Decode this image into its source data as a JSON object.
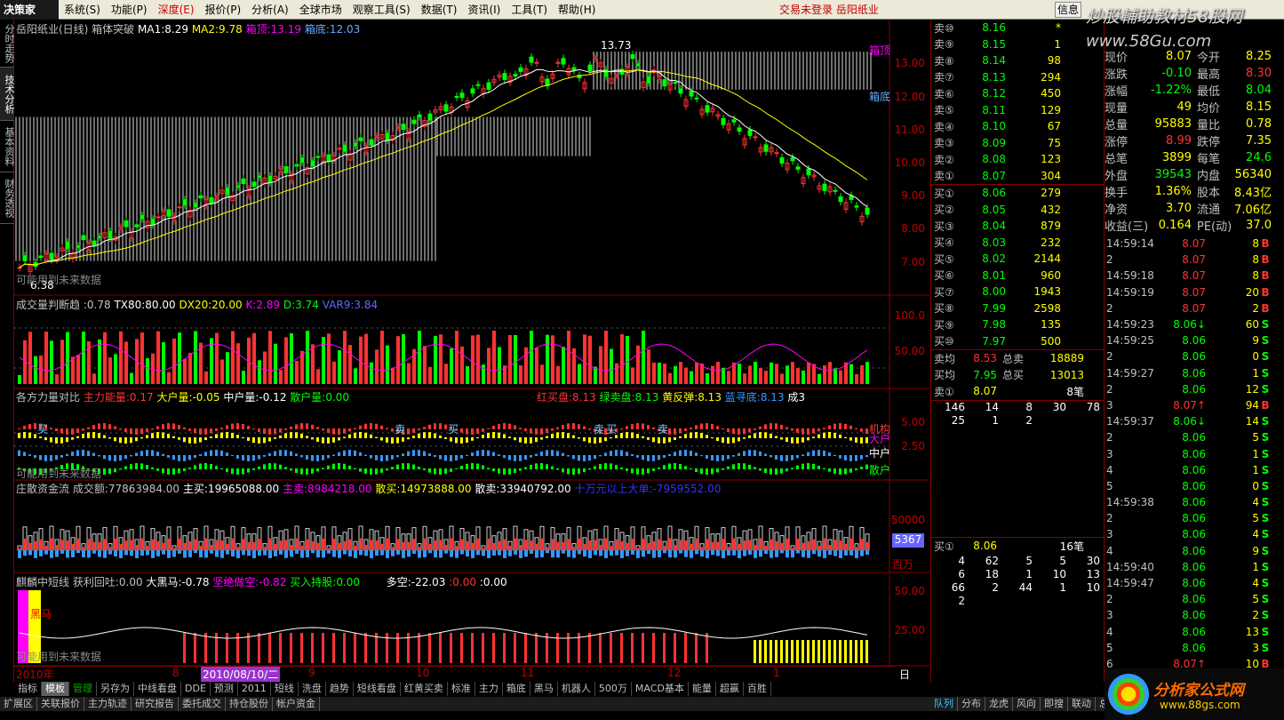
{
  "menu": {
    "logo": "决策家",
    "items": [
      "系统(S)",
      "功能(P)",
      "深度(E)",
      "报价(P)",
      "分析(A)",
      "全球市场",
      "观察工具(S)",
      "数据(T)",
      "资讯(I)",
      "工具(T)",
      "帮助(H)"
    ],
    "status": "交易未登录  岳阳纸业",
    "info": "信息",
    "watermark": "炒股輔助教材58股网",
    "watermark2": "www.58Gu.com"
  },
  "sidetabs": [
    "分时走势",
    "技术分析",
    "基本资料",
    "财务透视"
  ],
  "panel1": {
    "title": "岳阳纸业(日线) 箱体突破",
    "ma1": "MA1:8.29",
    "ma2": "MA2:9.78",
    "boxtop": "箱顶:13.19",
    "boxbottom": "箱底:12.03",
    "high_label": "13.73",
    "low_label": "6.38",
    "future": "可能用到未来数据",
    "boxtop_tag": "箱顶",
    "boxbottom_tag": "箱底",
    "axis": [
      "13.00",
      "12.00",
      "11.00",
      "10.00",
      "9.00",
      "8.00",
      "7.00"
    ]
  },
  "panel2": {
    "name": "成交量判断趋",
    "v1": ":0.78",
    "tx": "TX80:80.00",
    "dx": "DX20:20.00",
    "k": "K:2.89",
    "d": "D:3.74",
    "var9": "VAR9:3.84",
    "axis": [
      "100.0",
      "50.00"
    ]
  },
  "panel3": {
    "name": "各方力量对比",
    "zl": "主力能量:0.17",
    "dh": "大户量:-0.05",
    "zh": "中户量:-0.12",
    "sh": "散户量:0.00",
    "hm": "红买盘:8.13",
    "lm": "绿卖盘:8.13",
    "hf": "黄反弹:8.13",
    "ld": "蓝寻底:8.13",
    "cheng": "成3",
    "axis": [
      "5.00",
      "2.50"
    ],
    "tags": [
      "机构",
      "大户",
      "中户",
      "散户"
    ],
    "buy": "买",
    "sell": "卖",
    "future": "可能用到未来数据"
  },
  "panel4": {
    "name": "庄散资金流",
    "cje": "成交额:77863984.00",
    "zm": "主买:19965088.00",
    "zmai": "主卖:8984218.00",
    "sm": "散买:14973888.00",
    "smai": "散卖:33940792.00",
    "extra": "十万元以上大单:-7959552.00",
    "axis": [
      "50000"
    ],
    "box": "5367",
    "unit": "百万"
  },
  "panel5": {
    "name": "麒麟中短线",
    "hl": "获利回吐:0.00",
    "dhm": "大黑马:-0.78",
    "jj": "坚绝做空:-0.82",
    "mr": "买入持股:0.00",
    "dk": "多空:-22.03",
    "z1": ":0.00",
    "z2": ":0.00",
    "axis": [
      "50.00",
      "25.00"
    ],
    "hm": "黑马",
    "future": "可能用到未来数据"
  },
  "timeaxis": {
    "year": "2010年",
    "m8": "8",
    "date": "2010/08/10/二",
    "m9": "9",
    "m10": "10",
    "m11": "11",
    "m12": "12",
    "m1": "1",
    "period": "日线"
  },
  "orderbook": {
    "sells": [
      [
        "卖⑩",
        "8.16",
        "*"
      ],
      [
        "卖⑨",
        "8.15",
        "1"
      ],
      [
        "卖⑧",
        "8.14",
        "98"
      ],
      [
        "卖⑦",
        "8.13",
        "294"
      ],
      [
        "卖⑥",
        "8.12",
        "450"
      ],
      [
        "卖⑤",
        "8.11",
        "129"
      ],
      [
        "卖④",
        "8.10",
        "67"
      ],
      [
        "卖③",
        "8.09",
        "75"
      ],
      [
        "卖②",
        "8.08",
        "123"
      ],
      [
        "卖①",
        "8.07",
        "304"
      ]
    ],
    "buys": [
      [
        "买①",
        "8.06",
        "279"
      ],
      [
        "买②",
        "8.05",
        "432"
      ],
      [
        "买③",
        "8.04",
        "879"
      ],
      [
        "买④",
        "8.03",
        "232"
      ],
      [
        "买⑤",
        "8.02",
        "2144"
      ],
      [
        "买⑥",
        "8.01",
        "960"
      ],
      [
        "买⑦",
        "8.00",
        "1943"
      ],
      [
        "买⑧",
        "7.99",
        "2598"
      ],
      [
        "买⑨",
        "7.98",
        "135"
      ],
      [
        "买⑩",
        "7.97",
        "500"
      ]
    ],
    "avgsell": [
      "卖均",
      "8.53",
      "总卖",
      "18889"
    ],
    "avgbuy": [
      "买均",
      "7.95",
      "总买",
      "13013"
    ],
    "s1": [
      "卖①",
      "8.07",
      "8笔"
    ],
    "qrow1": [
      "146",
      "14",
      "8",
      "30",
      "78"
    ],
    "qrow2": [
      "25",
      "1",
      "2"
    ],
    "b1": [
      "买①",
      "8.06",
      "16笔"
    ],
    "brows": [
      [
        "4",
        "62",
        "5",
        "5",
        "30"
      ],
      [
        "6",
        "18",
        "1",
        "10",
        "13"
      ],
      [
        "66",
        "2",
        "44",
        "1",
        "10"
      ],
      [
        "2"
      ]
    ]
  },
  "quote": [
    [
      "现价",
      "8.07",
      "今开",
      "8.25"
    ],
    [
      "涨跌",
      "-0.10",
      "最高",
      "8.30"
    ],
    [
      "涨幅",
      "-1.22%",
      "最低",
      "8.04"
    ],
    [
      "现量",
      "49",
      "均价",
      "8.15"
    ],
    [
      "总量",
      "95883",
      "量比",
      "0.78"
    ],
    [
      "涨停",
      "8.99",
      "跌停",
      "7.35"
    ],
    [
      "总笔",
      "3899",
      "每笔",
      "24.6"
    ],
    [
      "外盘",
      "39543",
      "内盘",
      "56340"
    ],
    [
      "换手",
      "1.36%",
      "股本",
      "8.43亿"
    ],
    [
      "净资",
      "3.70",
      "流通",
      "7.06亿"
    ],
    [
      "收益(三)",
      "0.164",
      "PE(动)",
      "37.0"
    ]
  ],
  "ticks": [
    [
      "14:59:14",
      "8.07",
      "8",
      "B"
    ],
    [
      "2",
      "8.07",
      "8",
      "B"
    ],
    [
      "14:59:18",
      "8.07",
      "8",
      "B"
    ],
    [
      "14:59:19",
      "8.07",
      "20",
      "B"
    ],
    [
      "2",
      "8.07",
      "2",
      "B"
    ],
    [
      "14:59:23",
      "8.06↓",
      "60",
      "S"
    ],
    [
      "14:59:25",
      "8.06",
      "9",
      "S"
    ],
    [
      "2",
      "8.06",
      "0",
      "S"
    ],
    [
      "14:59:27",
      "8.06",
      "1",
      "S"
    ],
    [
      "2",
      "8.06",
      "12",
      "S"
    ],
    [
      "3",
      "8.07↑",
      "94",
      "B"
    ],
    [
      "14:59:37",
      "8.06↓",
      "14",
      "S"
    ],
    [
      "2",
      "8.06",
      "5",
      "S"
    ],
    [
      "3",
      "8.06",
      "1",
      "S"
    ],
    [
      "4",
      "8.06",
      "1",
      "S"
    ],
    [
      "5",
      "8.06",
      "0",
      "S"
    ],
    [
      "14:59:38",
      "8.06",
      "4",
      "S"
    ],
    [
      "2",
      "8.06",
      "5",
      "S"
    ],
    [
      "3",
      "8.06",
      "4",
      "S"
    ],
    [
      "4",
      "8.06",
      "9",
      "S"
    ],
    [
      "14:59:40",
      "8.06",
      "1",
      "S"
    ],
    [
      "14:59:47",
      "8.06",
      "4",
      "S"
    ],
    [
      "2",
      "8.06",
      "5",
      "S"
    ],
    [
      "3",
      "8.06",
      "2",
      "S"
    ],
    [
      "4",
      "8.06",
      "13",
      "S"
    ],
    [
      "5",
      "8.06",
      "3",
      "S"
    ],
    [
      "6",
      "8.07↑",
      "10",
      "B"
    ]
  ],
  "btabs1": [
    "指标",
    "模板",
    "管理",
    "另存为",
    "中线看盘",
    "DDE",
    "预测",
    "2011",
    "短线",
    "洗盘",
    "趋势",
    "短线看盘",
    "红黄买卖",
    "标准",
    "主力",
    "箱底",
    "黑马",
    "机器人",
    "500万",
    "MACD基本",
    "能量",
    "超赢",
    "百胜"
  ],
  "btabs2": [
    "扩展区",
    "关联报价",
    "主力轨迹",
    "研究报告",
    "委托成交",
    "持仓股份",
    "帐户资金"
  ],
  "btabs2r": [
    "队列",
    "分布",
    "龙虎",
    "风向",
    "即搜",
    "联动",
    "总景"
  ],
  "logo2": {
    "a": "分析家公式网",
    "b": "www.88gs.com"
  },
  "chart_data": {
    "type": "candlestick",
    "title": "岳阳纸业(日线) 箱体突破",
    "close_last": 8.07,
    "box_top": 13.19,
    "box_bottom": 12.03,
    "high": 13.73,
    "low": 6.38,
    "ma1": 8.29,
    "ma2": 9.78,
    "ylim": [
      6.3,
      13.9
    ]
  }
}
